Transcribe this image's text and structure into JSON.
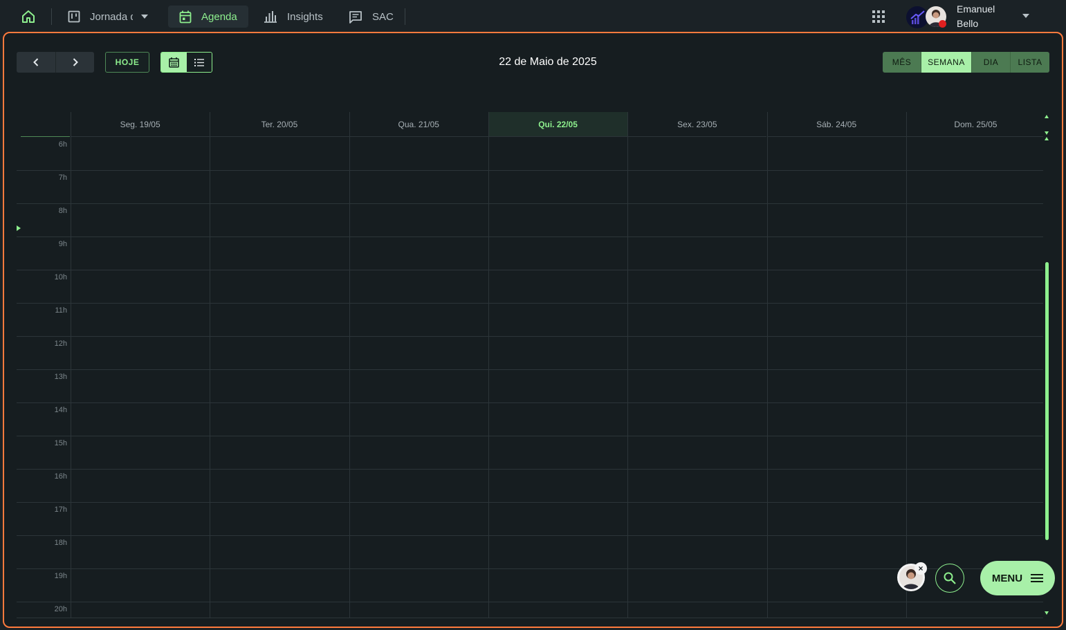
{
  "topnav": {
    "home_icon": "home-icon",
    "items": [
      {
        "label": "Jornada d",
        "icon": "kanban-icon"
      },
      {
        "label": "Agenda",
        "icon": "calendar-icon"
      },
      {
        "label": "Insights",
        "icon": "bar-chart-icon"
      },
      {
        "label": "SAC",
        "icon": "chat-icon"
      }
    ],
    "apps_icon": "apps-grid-icon",
    "user": {
      "first_name": "Emanuel",
      "last_name": "Bello",
      "status_color": "#e02020"
    }
  },
  "toolbar": {
    "today_label": "HOJE",
    "title": "22 de Maio de 2025",
    "modes": [
      "MÊS",
      "SEMANA",
      "DIA",
      "LISTA"
    ],
    "active_mode": "SEMANA"
  },
  "calendar": {
    "days": [
      "Seg. 19/05",
      "Ter. 20/05",
      "Qua. 21/05",
      "Qui. 22/05",
      "Sex. 23/05",
      "Sáb. 24/05",
      "Dom. 25/05"
    ],
    "today_index": 3,
    "hours": [
      "6h",
      "7h",
      "8h",
      "9h",
      "10h",
      "11h",
      "12h",
      "13h",
      "14h",
      "15h",
      "16h",
      "17h",
      "18h",
      "19h",
      "20h"
    ]
  },
  "fabs": {
    "close_glyph": "×",
    "menu_label": "MENU"
  },
  "colors": {
    "accent": "#8ef08e",
    "panel_border": "#ff7a3d",
    "background": "#161d20"
  }
}
